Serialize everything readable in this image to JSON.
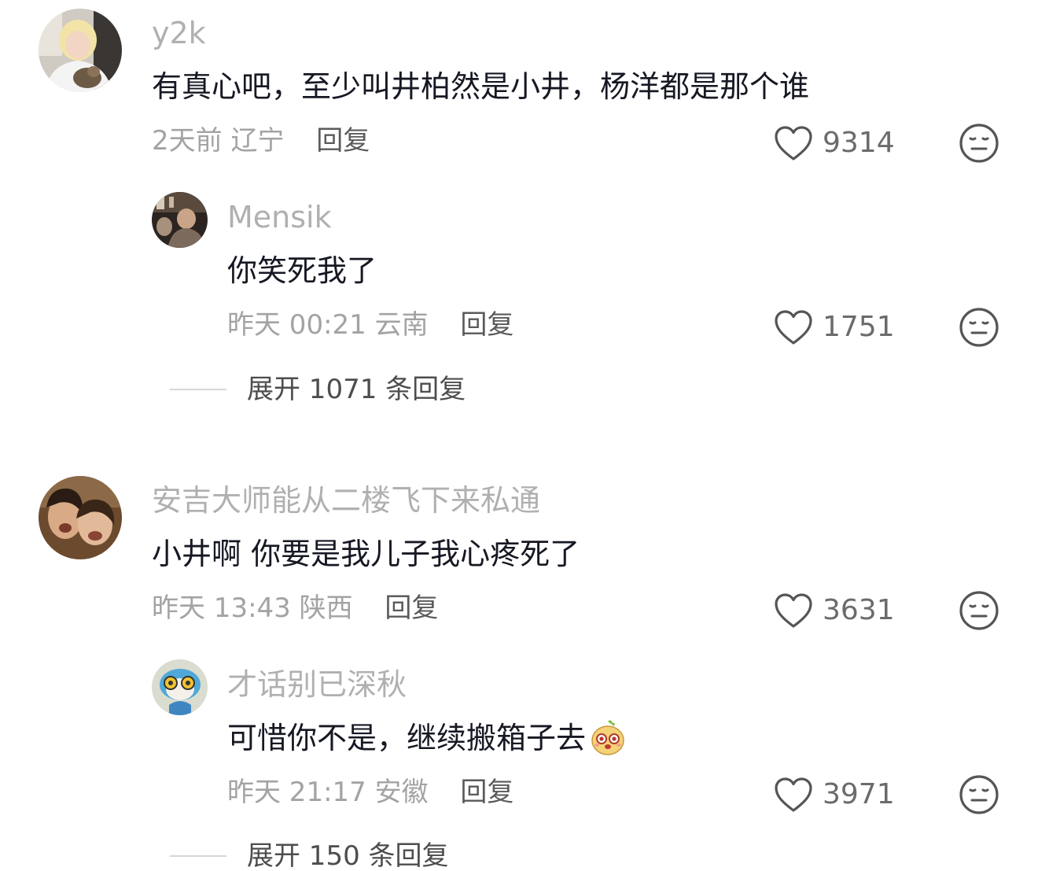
{
  "comments": [
    {
      "username": "y2k",
      "content": "有真心吧，至少叫井柏然是小井，杨洋都是那个谁",
      "time": "2天前",
      "location": "辽宁",
      "reply_label": "回复",
      "likes": "9314",
      "avatar_icon": "avatar-person-with-cat",
      "replies": [
        {
          "username": "Mensik",
          "content": "你笑死我了",
          "time": "昨天 00:21",
          "location": "云南",
          "reply_label": "回复",
          "likes": "1751",
          "avatar_icon": "avatar-dark-photo"
        }
      ],
      "expand_label": "展开 1071 条回复"
    },
    {
      "username": "安吉大师能从二楼飞下来私通",
      "content": "小井啊 你要是我儿子我心疼死了",
      "time": "昨天 13:43",
      "location": "陕西",
      "reply_label": "回复",
      "likes": "3631",
      "avatar_icon": "avatar-two-women",
      "replies": [
        {
          "username": "才话别已深秋",
          "content": "可惜你不是，继续搬箱子去",
          "emoji": "cute-potato-emoji",
          "time": "昨天 21:17",
          "location": "安徽",
          "reply_label": "回复",
          "likes": "3971",
          "avatar_icon": "avatar-cartoon-character"
        }
      ],
      "expand_label": "展开 150 条回复"
    }
  ],
  "icons": {
    "like": "heart-outline-icon",
    "dislike": "meh-face-icon"
  },
  "colors": {
    "username": "#b0b0b0",
    "content": "#161823",
    "meta": "#a3a3a3",
    "icon": "#6b6b6b"
  }
}
